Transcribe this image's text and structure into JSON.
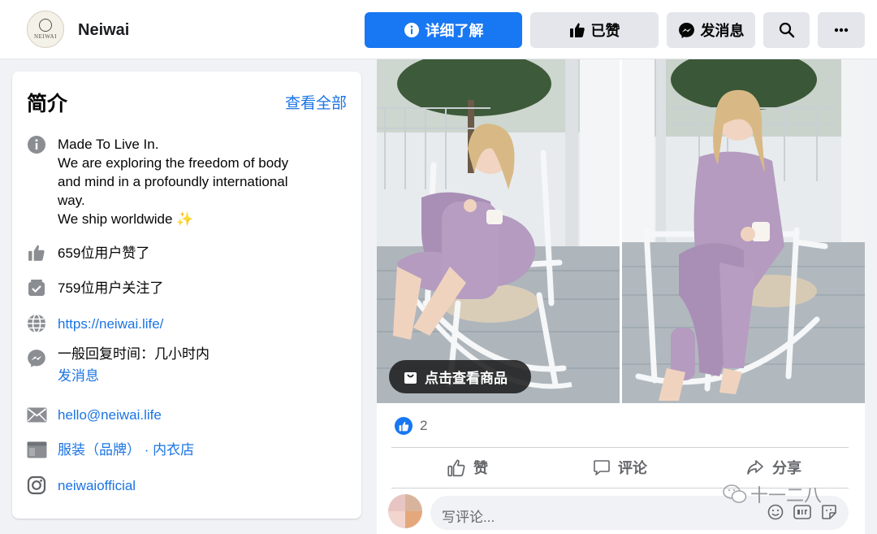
{
  "header": {
    "logo_text": "NEIWAI",
    "page_name": "Neiwai",
    "learn_more_label": "详细了解",
    "liked_label": "已赞",
    "message_label": "发消息"
  },
  "intro": {
    "title": "简介",
    "see_all": "查看全部",
    "bio_lines": [
      "Made To Live In.",
      "We are exploring the freedom of body",
      "and mind in a profoundly international",
      "way.",
      "We ship worldwide ✨"
    ],
    "likes": "659位用户赞了",
    "followers": "759位用户关注了",
    "website": "https://neiwai.life/",
    "response_time": "一般回复时间：几小时内",
    "send_message": "发消息",
    "email": "hello@neiwai.life",
    "category": "服装（品牌） · 内衣店",
    "instagram": "neiwaiofficial"
  },
  "post": {
    "shop_label": "点击查看商品",
    "reaction_count": "2",
    "like_label": "赞",
    "comment_label": "评论",
    "share_label": "分享",
    "comment_placeholder": "写评论..."
  },
  "watermark": {
    "text": "十一二八"
  },
  "colors": {
    "brand_blue": "#1877f2",
    "link_blue": "#1b74e4",
    "button_gray": "#e4e6eb",
    "page_bg": "#f0f2f5"
  }
}
